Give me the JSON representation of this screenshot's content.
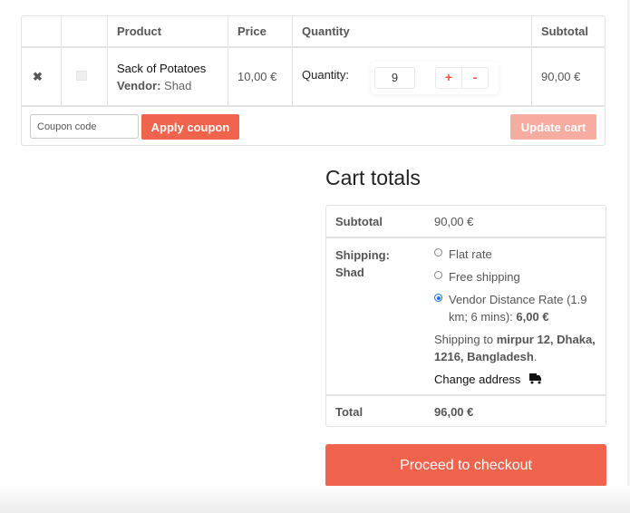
{
  "cart": {
    "headers": {
      "remove": "",
      "thumbnail": "",
      "product": "Product",
      "price": "Price",
      "quantity": "Quantity",
      "subtotal": "Subtotal"
    },
    "items": [
      {
        "remove_icon": "✖",
        "product_name": "Sack of Potatoes",
        "vendor_label": "Vendor:",
        "vendor_name": "Shad",
        "price": "10,00 €",
        "quantity_label": "Quantity:",
        "quantity": "9",
        "plus_label": "+",
        "minus_label": "-",
        "subtotal": "90,00 €"
      }
    ],
    "coupon_placeholder": "Coupon code",
    "apply_coupon_label": "Apply coupon",
    "update_cart_label": "Update cart"
  },
  "totals": {
    "title": "Cart totals",
    "subtotal_label": "Subtotal",
    "subtotal_value": "90,00 €",
    "shipping_label_line1": "Shipping:",
    "shipping_label_line2": "Shad",
    "shipping_options": [
      {
        "label": "Flat rate",
        "selected": false
      },
      {
        "label": "Free shipping",
        "selected": false
      },
      {
        "label": "Vendor Distance Rate (1.9 km; 6 mins):",
        "price": "6,00 €",
        "selected": true
      }
    ],
    "shipping_to_prefix": "Shipping to",
    "shipping_to_address": "mirpur 12, Dhaka, 1216, Bangladesh",
    "shipping_to_suffix": ".",
    "change_address_label": "Change address",
    "change_address_icon": "truck-icon",
    "total_label": "Total",
    "total_value": "96,00 €"
  },
  "checkout_label": "Proceed to checkout",
  "colors": {
    "accent": "#f0634c",
    "accent_disabled": "#f6aca0",
    "remove": "#e02b27",
    "radio_selected": "#1a73e8"
  }
}
